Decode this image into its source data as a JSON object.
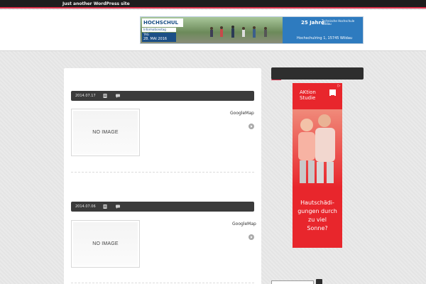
{
  "site": {
    "tagline": "Just another WordPress site"
  },
  "header_banner": {
    "logo_text": "HOCHSCHUL",
    "sub_line_1": "Informationstag",
    "sub_line_2": "TAG",
    "date_text": "28. MAI 2016",
    "time_text": "10.30 – 16 UHR",
    "anniversary_text": "25 Jahre",
    "institution_text": "Technische Hochschule Wildau",
    "address_text": "Hochschulring 1, 15745 Wildau"
  },
  "posts": [
    {
      "date": "2014.07.17",
      "title": "GoogleMap",
      "thumbnail_text": "NO IMAGE"
    },
    {
      "date": "2014.07.06",
      "title": "GoogleMap",
      "thumbnail_text": "NO IMAGE"
    }
  ],
  "sidebar": {
    "widget_title": "",
    "ad": {
      "title_line_1": "AKtion",
      "title_line_2": "Studie",
      "body_line_1": "Hautschädi-",
      "body_line_2": "gungen durch",
      "body_line_3": "zu viel",
      "body_line_4": "Sonne?",
      "choices_label": "▷"
    },
    "search": {
      "placeholder": "",
      "value": ""
    }
  },
  "colors": {
    "topbar": "#1d1d1d",
    "accent": "#d9304a",
    "meta_bar": "#3b3b3b",
    "ad_red": "#e8262c",
    "banner_blue": "#2e7bbf"
  }
}
